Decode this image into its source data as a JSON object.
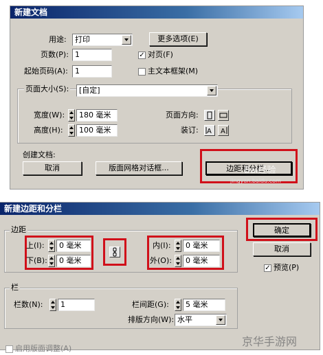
{
  "dialog1": {
    "title": "新建文档",
    "purpose_label": "用途:",
    "purpose_value": "打印",
    "more_options": "更多选项(E)",
    "pages_label": "页数(P):",
    "pages_value": "1",
    "facing_pages": "对页(F)",
    "facing_checked": "✓",
    "start_page_label": "起始页码(A):",
    "start_page_value": "1",
    "master_text": "主文本框架(M)",
    "page_size_label": "页面大小(S):",
    "page_size_value": "[自定]",
    "width_label": "宽度(W):",
    "width_value": "180 毫米",
    "height_label": "高度(H):",
    "height_value": "100 毫米",
    "orientation_label": "页面方向:",
    "binding_label": "装订:",
    "create_label": "创建文档:",
    "cancel": "取消",
    "grid_dialog": "版面网格对话框...",
    "margins_columns": "边距和分栏..."
  },
  "dialog2": {
    "title": "新建边距和分栏",
    "margins_title": "边距",
    "top_label": "上(I):",
    "top_value": "0 毫米",
    "bottom_label": "下(B):",
    "bottom_value": "0 毫米",
    "inside_label": "内(I):",
    "inside_value": "0 毫米",
    "outside_label": "外(O):",
    "outside_value": "0 毫米",
    "ok": "确定",
    "cancel": "取消",
    "preview": "预览(P)",
    "preview_checked": "✓",
    "columns_title": "栏",
    "columns_label": "栏数(N):",
    "columns_value": "1",
    "gutter_label": "栏间距(G):",
    "gutter_value": "5 毫米",
    "direction_label": "排版方向(W):",
    "direction_value": "水平",
    "layout_adjust": "启用版面调整(A)"
  },
  "watermarks": {
    "top": "Bai经验",
    "top_url": "jingyan.baidu.com",
    "bottom": "京华手游网"
  },
  "colors": {
    "highlight": "#d0101a",
    "dialog_bg": "#d4d0c8",
    "title_bar": "#0a246a"
  }
}
